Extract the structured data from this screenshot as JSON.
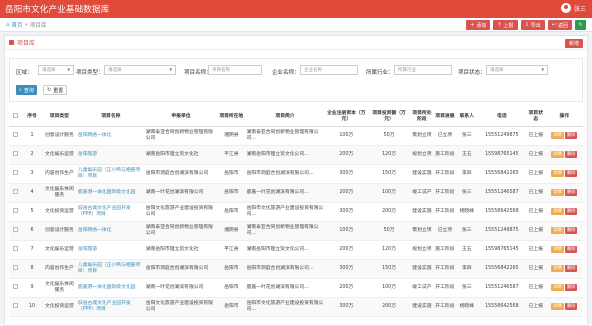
{
  "app": {
    "title": "岳阳市文化产业基础数据库",
    "user": "张三"
  },
  "breadcrumb": {
    "home": "首页",
    "sep": "»",
    "current": "项目库"
  },
  "toolbar": {
    "add": "添加",
    "upload": "上报",
    "export": "导出",
    "back": "返回"
  },
  "panel": {
    "title": "项目库",
    "add_button": "新增"
  },
  "filters": {
    "region_label": "区域：",
    "region_value": "请选择",
    "type_label": "项目类型：",
    "type_value": "请选择",
    "name_label": "项目名称：",
    "name_placeholder": "项目名称",
    "company_label": "企业名称：",
    "company_placeholder": "企业名称",
    "industry_label": "所属行业：",
    "industry_placeholder": "所属行业",
    "status_label": "项目状态：",
    "status_value": "请选择",
    "search": "查询",
    "reset": "重置"
  },
  "colors": {
    "primary": "#e04a3b",
    "link": "#3c8dbc",
    "warning": "#f0ad4e",
    "danger": "#d9534f"
  },
  "table": {
    "headers": [
      "序号",
      "项目类型",
      "项目名称",
      "申报单位",
      "项目所在地",
      "项目简介",
      "企业注册资本（万元）",
      "项目投资额（万元）",
      "项目所处阶段",
      "项目进展",
      "联系人",
      "电话",
      "项目状态",
      "操作"
    ],
    "op_detail": "详情",
    "op_delete": "删除",
    "rows": [
      [
        "1",
        "创意设计服务",
        "岳阳网络一体化",
        "湖南泰亚合同创新物业管理有限公司",
        "湘阴县",
        "湖南泰亚合同创新物业管理有限公司...",
        "100万",
        "50万",
        "策划立项",
        "已立项",
        "张三",
        "15551249875",
        "已上报"
      ],
      [
        "2",
        "文化娱乐运营",
        "岳阳旅游",
        "湖南岳阳市锂立贸文化社",
        "平江县",
        "湖南岳阳市锂立贸文化公司...",
        "200万",
        "120万",
        "规划立项",
        "施工阶段",
        "王五",
        "15598765145",
        "已上报"
      ],
      [
        "3",
        "内容创作生产",
        "儿童娱乐园（正小鸭与相册项目）项目",
        "岳阳市洞庭合创湖滨有限公司",
        "岳阳市",
        "岳阳市洞庭合创湖滨有限公司...",
        "300万",
        "150万",
        "建设实施",
        "开工阶段",
        "李四",
        "15556842265",
        "已上报"
      ],
      [
        "4",
        "文化娱乐休闲服务",
        "鹿嘉港一体化国际级文化园",
        "湖南一叶花创湖滨有限公司",
        "岳阳市",
        "鹿嘉一叶花创湖滨有限公司...",
        "200万",
        "100万",
        "竣工试产",
        "开工阶段",
        "张三",
        "15551246587",
        "已上报"
      ],
      [
        "5",
        "文化投资运营",
        "旧岳古城文化产业园开发（PPP）项目",
        "岳阳文化旅游产业建设投资有限公司",
        "岳阳市",
        "岳阳市文化旅游产业建设投资有限公司...",
        "300万",
        "200万",
        "建设实施",
        "开工阶段",
        "杨晓峰",
        "15558642568",
        "已上报"
      ],
      [
        "6",
        "创意设计服务",
        "岳阳网络一体化",
        "湖南泰亚合同创新物业管理有限公司",
        "湘阴县",
        "湖南泰亚合同创新物业管理有限公司...",
        "100万",
        "50万",
        "策划立项",
        "已立项",
        "张三",
        "15551249875",
        "已上报"
      ],
      [
        "7",
        "文化娱乐运营",
        "岳阳旅游",
        "湖南岳阳市锂立贸文化社",
        "平江县",
        "湖南岳阳市锂立贸文化公司...",
        "200万",
        "120万",
        "规划立项",
        "施工阶段",
        "王五",
        "15598765145",
        "已上报"
      ],
      [
        "8",
        "内容创作生产",
        "儿童娱乐园（正小鸭与相册项目）项目",
        "岳阳市洞庭合创湖滨有限公司",
        "岳阳市",
        "岳阳市洞庭合创湖滨有限公司...",
        "300万",
        "150万",
        "建设实施",
        "开工阶段",
        "李四",
        "15556842265",
        "已上报"
      ],
      [
        "9",
        "文化娱乐休闲服务",
        "鹿嘉港一体化国际级文化园",
        "湖南一叶花创湖滨有限公司",
        "岳阳市",
        "鹿嘉一叶花创湖滨有限公司...",
        "200万",
        "100万",
        "竣工试产",
        "开工阶段",
        "张三",
        "15551246587",
        "已上报"
      ],
      [
        "10",
        "文化投资运营",
        "旧岳古城文化产业园开发（PPP）项目",
        "岳阳文化旅游产业建设投资有限公司",
        "岳阳市",
        "岳阳市文化旅游产业建设投资有限公司...",
        "300万",
        "200万",
        "建设实施",
        "开工阶段",
        "杨晓峰",
        "15558642568",
        "已上报"
      ]
    ]
  }
}
